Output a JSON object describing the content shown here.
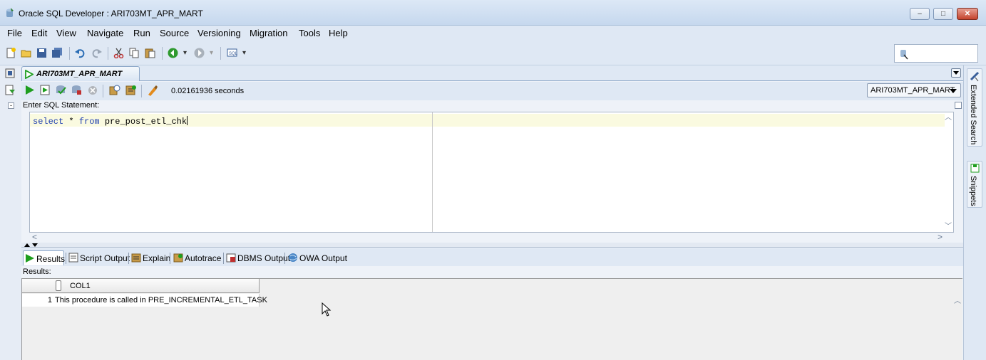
{
  "window": {
    "title": "Oracle SQL Developer : ARI703MT_APR_MART",
    "minimize_glyph": "–",
    "maximize_glyph": "□",
    "close_glyph": "✕"
  },
  "menu": [
    "File",
    "Edit",
    "View",
    "Navigate",
    "Run",
    "Source",
    "Versioning",
    "Migration",
    "Tools",
    "Help"
  ],
  "toolbar": {
    "icons": [
      "new-icon",
      "open-icon",
      "save-icon",
      "save-all-icon",
      "undo-icon",
      "redo-icon",
      "cut-icon",
      "copy-icon",
      "paste-icon",
      "back-icon",
      "forward-icon",
      "sql-icon"
    ]
  },
  "worksheet": {
    "tab_label": "ARI703MT_APR_MART",
    "elapsed": "0.02161936 seconds",
    "connection": "ARI703MT_APR_MART",
    "statement_label": "Enter SQL Statement:",
    "sql": {
      "kw1": "select",
      "star": " * ",
      "kw2": "from",
      "rest": " pre_post_etl_chk"
    },
    "hscroll_left": "<",
    "hscroll_right": ">",
    "vscroll_up": "^",
    "vscroll_down": "v"
  },
  "right_sidebar": {
    "extended_search": "Extended Search",
    "snippets": "Snippets"
  },
  "output_tabs": [
    {
      "label": "Results",
      "icon": "play-icon",
      "active": true
    },
    {
      "label": "Script Output",
      "icon": "script-icon"
    },
    {
      "label": "Explain",
      "icon": "explain-icon"
    },
    {
      "label": "Autotrace",
      "icon": "autotrace-icon"
    },
    {
      "label": "DBMS Output",
      "icon": "dbms-icon"
    },
    {
      "label": "OWA Output",
      "icon": "owa-icon"
    }
  ],
  "results": {
    "label": "Results:",
    "columns": [
      "COL1"
    ],
    "rows": [
      {
        "num": "1",
        "col1": "This procedure is called in PRE_INCREMENTAL_ETL_TASK"
      }
    ]
  },
  "colors": {
    "chrome": "#dfe8f4",
    "keyword": "#1f3fb0",
    "current_line": "#fafae0",
    "run_green": "#1e9e1e"
  }
}
